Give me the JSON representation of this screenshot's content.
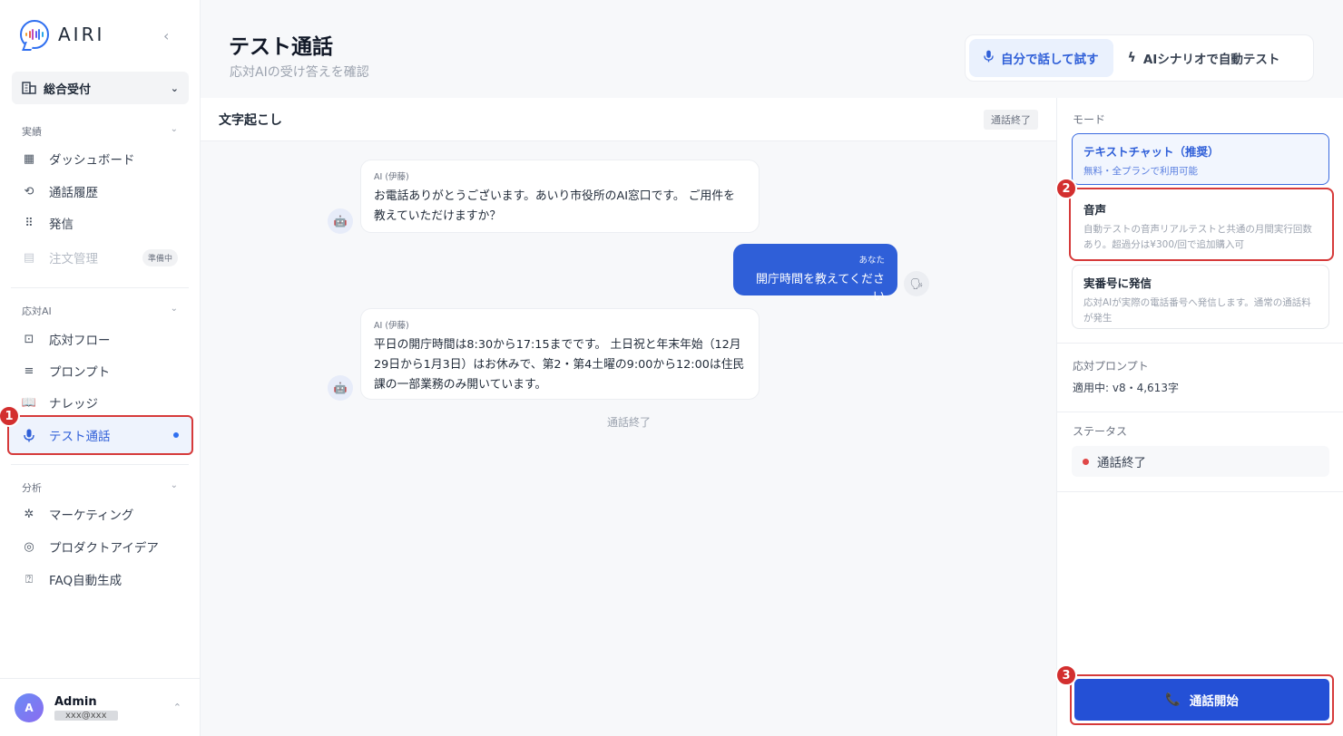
{
  "brand": {
    "name": "AIRI"
  },
  "org": {
    "label": "総合受付"
  },
  "sections": {
    "performance": "実績",
    "ai": "応対AI",
    "analysis": "分析"
  },
  "nav": {
    "dashboard": "ダッシュボード",
    "history": "通話履歴",
    "outbound": "発信",
    "orders": "注文管理",
    "orders_badge": "準備中",
    "flow": "応対フロー",
    "prompt": "プロンプト",
    "knowledge": "ナレッジ",
    "test_call": "テスト通話",
    "marketing": "マーケティング",
    "ideas": "プロダクトアイデア",
    "faq": "FAQ自動生成"
  },
  "user": {
    "name": "Admin",
    "email": "xxx@xxx",
    "avatar_initial": "A"
  },
  "header": {
    "title": "テスト通話",
    "subtitle": "応対AIの受け答えを確認",
    "mode_self": "自分で話して試す",
    "mode_auto": "AIシナリオで自動テスト"
  },
  "transcript": {
    "title": "文字起こし",
    "status": "通話終了",
    "messages": [
      {
        "who": "AI (伊藤)",
        "text": "お電話ありがとうございます。あいり市役所のAI窓口です。 ご用件を教えていただけますか？"
      },
      {
        "who": "あなた",
        "text": "開庁時間を教えてください"
      },
      {
        "who": "AI (伊藤)",
        "text": "平日の開庁時間は8:30から17:15までです。 土日祝と年末年始（12月29日から1月3日）はお休みで、第2・第4土曜の9:00から12:00は住民課の一部業務のみ開いています。"
      }
    ],
    "end_note": "通話終了"
  },
  "panel": {
    "mode_label": "モード",
    "modes": [
      {
        "title": "テキストチャット（推奨）",
        "desc": "無料・全プランで利用可能"
      },
      {
        "title": "音声",
        "desc": "自動テストの音声リアルテストと共通の月間実行回数あり。超過分は¥300/回で追加購入可"
      },
      {
        "title": "実番号に発信",
        "desc": "応対AIが実際の電話番号へ発信します。通常の通話料が発生"
      }
    ],
    "prompt_label": "応対プロンプト",
    "prompt_value": "適用中: v8・4,613字",
    "status_label": "ステータス",
    "status_value": "通話終了",
    "start_button": "通話開始"
  },
  "callouts": [
    "1",
    "2",
    "3"
  ],
  "colors": {
    "accent": "#2f5fd8",
    "highlight": "#d63a3a",
    "status_red": "#e04848"
  }
}
